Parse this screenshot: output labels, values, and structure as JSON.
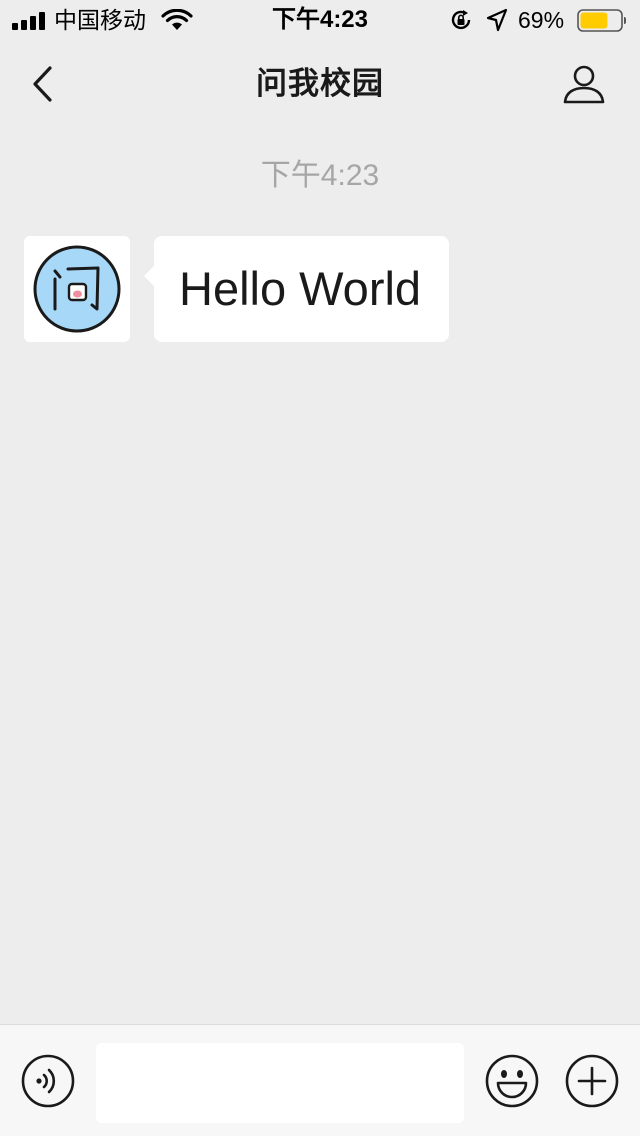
{
  "status_bar": {
    "carrier": "中国移动",
    "time": "下午4:23",
    "battery_percent": "69%",
    "battery_level": 0.69,
    "battery_color": "#ffcc00",
    "icons": [
      "signal-icon",
      "wifi-icon",
      "rotation-lock-icon",
      "location-arrow-icon",
      "battery-icon"
    ]
  },
  "nav": {
    "title": "问我校园",
    "back_icon": "chevron-left-icon",
    "profile_icon": "person-icon"
  },
  "chat": {
    "timestamp": "下午4:23",
    "messages": [
      {
        "sender_avatar": "问",
        "avatar_color": "#a8d8f8",
        "text": "Hello World"
      }
    ]
  },
  "input_bar": {
    "voice_icon": "voice-icon",
    "input_value": "",
    "emoji_icon": "emoji-icon",
    "more_icon": "plus-circle-icon"
  }
}
